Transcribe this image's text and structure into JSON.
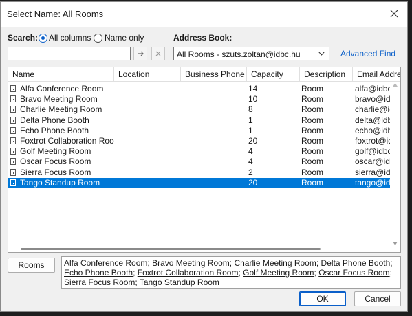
{
  "window": {
    "title": "Select Name: All Rooms"
  },
  "search": {
    "label": "Search:",
    "options": [
      "All columns",
      "Name only"
    ],
    "selected": "All columns",
    "input_value": ""
  },
  "address_book": {
    "label": "Address Book:",
    "value": "All Rooms - szuts.zoltan@idbc.hu",
    "advanced_find": "Advanced Find"
  },
  "table": {
    "columns": [
      "Name",
      "Location",
      "Business Phone",
      "Capacity",
      "Description",
      "Email Addres"
    ],
    "rows": [
      {
        "name": "Alfa Conference Room",
        "location": "",
        "phone": "",
        "capacity": "14",
        "description": "Room",
        "email": "alfa@idbc.l"
      },
      {
        "name": "Bravo Meeting Room",
        "location": "",
        "phone": "",
        "capacity": "10",
        "description": "Room",
        "email": "bravo@idbc"
      },
      {
        "name": "Charlie Meeting Room",
        "location": "",
        "phone": "",
        "capacity": "8",
        "description": "Room",
        "email": "charlie@idb"
      },
      {
        "name": "Delta Phone Booth",
        "location": "",
        "phone": "",
        "capacity": "1",
        "description": "Room",
        "email": "delta@idbc"
      },
      {
        "name": "Echo Phone Booth",
        "location": "",
        "phone": "",
        "capacity": "1",
        "description": "Room",
        "email": "echo@idbc"
      },
      {
        "name": "Foxtrot Collaboration Room",
        "location": "",
        "phone": "",
        "capacity": "20",
        "description": "Room",
        "email": "foxtrot@id"
      },
      {
        "name": "Golf Meeting Room",
        "location": "",
        "phone": "",
        "capacity": "4",
        "description": "Room",
        "email": "golf@idbc."
      },
      {
        "name": "Oscar Focus Room",
        "location": "",
        "phone": "",
        "capacity": "4",
        "description": "Room",
        "email": "oscar@idbc"
      },
      {
        "name": "Sierra Focus Room",
        "location": "",
        "phone": "",
        "capacity": "2",
        "description": "Room",
        "email": "sierra@idb"
      },
      {
        "name": "Tango Standup Room",
        "location": "",
        "phone": "",
        "capacity": "20",
        "description": "Room",
        "email": "tango@idb"
      }
    ],
    "selected_index": 9
  },
  "rooms_button": "Rooms",
  "selection": {
    "items": [
      "Alfa Conference Room",
      "Bravo Meeting Room",
      "Charlie Meeting Room",
      "Delta Phone Booth",
      "Echo Phone Booth",
      "Foxtrot Collaboration Room",
      "Golf Meeting Room",
      "Oscar Focus Room",
      "Sierra Focus Room",
      "Tango Standup Room"
    ],
    "separator": "; "
  },
  "buttons": {
    "ok": "OK",
    "cancel": "Cancel"
  },
  "colors": {
    "accent": "#0a5fc9",
    "selection": "#0078d7"
  }
}
